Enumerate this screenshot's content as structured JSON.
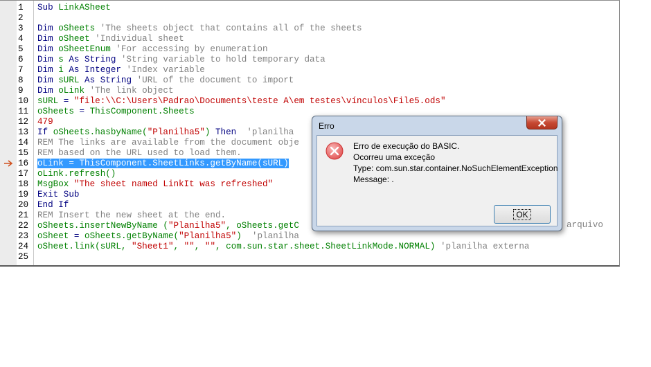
{
  "editor": {
    "line_numbers": [
      "1",
      "2",
      "3",
      "4",
      "5",
      "6",
      "7",
      "8",
      "9",
      "10",
      "11",
      "12",
      "13",
      "14",
      "15",
      "16",
      "17",
      "18",
      "19",
      "20",
      "21",
      "22",
      "23",
      "24",
      "25"
    ],
    "current_line": "16",
    "lines": [
      [
        {
          "t": "Sub ",
          "c": "kw"
        },
        {
          "t": "LinkASheet",
          "c": "id"
        }
      ],
      [],
      [
        {
          "t": "Dim ",
          "c": "kw"
        },
        {
          "t": "oSheets",
          "c": "id"
        },
        {
          "t": " 'The sheets object that contains all of the sheets",
          "c": "cm"
        }
      ],
      [
        {
          "t": "Dim ",
          "c": "kw"
        },
        {
          "t": "oSheet",
          "c": "id"
        },
        {
          "t": " 'Individual sheet",
          "c": "cm"
        }
      ],
      [
        {
          "t": "Dim ",
          "c": "kw"
        },
        {
          "t": "oSheetEnum",
          "c": "id"
        },
        {
          "t": " 'For accessing by enumeration",
          "c": "cm"
        }
      ],
      [
        {
          "t": "Dim ",
          "c": "kw"
        },
        {
          "t": "s",
          "c": "id"
        },
        {
          "t": " As String",
          "c": "kw"
        },
        {
          "t": " 'String variable to hold temporary data",
          "c": "cm"
        }
      ],
      [
        {
          "t": "Dim ",
          "c": "kw"
        },
        {
          "t": "i",
          "c": "id"
        },
        {
          "t": " As Integer",
          "c": "kw"
        },
        {
          "t": " 'Index variable",
          "c": "cm"
        }
      ],
      [
        {
          "t": "Dim ",
          "c": "kw"
        },
        {
          "t": "sURL",
          "c": "id"
        },
        {
          "t": " As String",
          "c": "kw"
        },
        {
          "t": " 'URL of the document to import",
          "c": "cm"
        }
      ],
      [
        {
          "t": "Dim ",
          "c": "kw"
        },
        {
          "t": "oLink",
          "c": "id"
        },
        {
          "t": " 'The link object",
          "c": "cm"
        }
      ],
      [
        {
          "t": "sURL",
          "c": "id"
        },
        {
          "t": " = ",
          "c": "op"
        },
        {
          "t": "\"file:\\\\C:\\Users\\Padrao\\Documents\\teste A\\em testes\\vínculos\\File5.ods\"",
          "c": "str"
        }
      ],
      [
        {
          "t": "oSheets",
          "c": "id"
        },
        {
          "t": " = ",
          "c": "op"
        },
        {
          "t": "ThisComponent.Sheets",
          "c": "id"
        }
      ],
      [
        {
          "t": "479",
          "c": "num"
        }
      ],
      [
        {
          "t": "If ",
          "c": "kw"
        },
        {
          "t": "oSheets.hasbyName(",
          "c": "id"
        },
        {
          "t": "\"Planilha5\"",
          "c": "str"
        },
        {
          "t": ") ",
          "c": "id"
        },
        {
          "t": "Then",
          "c": "kw"
        },
        {
          "t": "  'planilha",
          "c": "cm"
        }
      ],
      [
        {
          "t": "REM The links are available from the document obje",
          "c": "cm"
        }
      ],
      [
        {
          "t": "REM based on the URL used to load them.",
          "c": "cm"
        }
      ],
      [
        {
          "t": "oLink = ThisComponent.SheetLinks.getByName(sURL)",
          "c": "hl"
        }
      ],
      [
        {
          "t": "oLink.refresh()",
          "c": "id"
        }
      ],
      [
        {
          "t": "MsgBox ",
          "c": "id"
        },
        {
          "t": "\"The sheet named LinkIt was refreshed\"",
          "c": "str"
        }
      ],
      [
        {
          "t": "Exit Sub",
          "c": "kw"
        }
      ],
      [
        {
          "t": "End If",
          "c": "kw"
        }
      ],
      [
        {
          "t": "REM Insert the new sheet at the end.",
          "c": "cm"
        }
      ],
      [
        {
          "t": "oSheets.insertNewByName (",
          "c": "id"
        },
        {
          "t": "\"Planilha5\"",
          "c": "str"
        },
        {
          "t": ", ",
          "c": "id"
        },
        {
          "t": "oSheets.getC",
          "c": "id"
        }
      ],
      [
        {
          "t": "oSheet",
          "c": "id"
        },
        {
          "t": " = ",
          "c": "op"
        },
        {
          "t": "oSheets.getByName(",
          "c": "id"
        },
        {
          "t": "\"Planilha5\"",
          "c": "str"
        },
        {
          "t": ")  ",
          "c": "id"
        },
        {
          "t": "'planilha",
          "c": "cm"
        }
      ],
      [
        {
          "t": "oSheet.link(sURL, ",
          "c": "id"
        },
        {
          "t": "\"Sheet1\"",
          "c": "str"
        },
        {
          "t": ", ",
          "c": "id"
        },
        {
          "t": "\"\"",
          "c": "str"
        },
        {
          "t": ", ",
          "c": "id"
        },
        {
          "t": "\"\"",
          "c": "str"
        },
        {
          "t": ", com.sun.star.sheet.SheetLinkMode.NORMAL) ",
          "c": "id"
        },
        {
          "t": "'planilha externa",
          "c": "cm"
        }
      ],
      []
    ],
    "overflow_right_line22": "arquivo"
  },
  "dialog": {
    "title": "Erro",
    "close_icon": "close-icon",
    "error_icon": "error-icon",
    "messages": [
      "Erro de execução do BASIC.",
      "Ocorreu uma exceção",
      "Type: com.sun.star.container.NoSuchElementException",
      "Message: ."
    ],
    "ok_label": "OK"
  },
  "colors": {
    "keyword": "#000080",
    "identifier": "#008000",
    "string": "#c00000",
    "comment": "#808080",
    "highlight": "#3399ff",
    "close_button": "#c74a34"
  }
}
